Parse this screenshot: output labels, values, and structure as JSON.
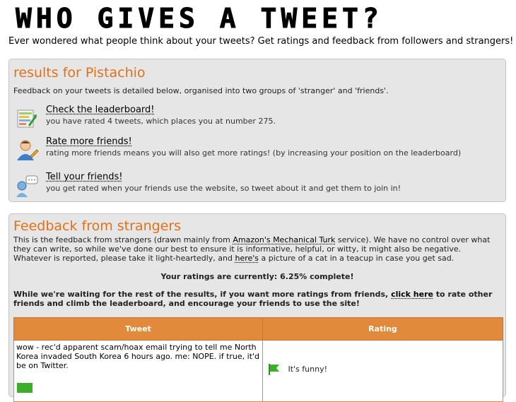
{
  "site": {
    "title": "WHO GIVES A TWEET?",
    "tagline": "Ever wondered what people think about your tweets? Get ratings and feedback from followers and strangers!"
  },
  "results": {
    "heading": "results for Pistachio",
    "intro": "Feedback on your tweets is detailed below, organised into two groups of 'stranger' and 'friends'.",
    "items": [
      {
        "icon": "leaderboard-icon",
        "title": "Check the leaderboard!",
        "desc": "you have rated 4 tweets, which places you at number 275."
      },
      {
        "icon": "rate-friends-icon",
        "title": "Rate more friends!",
        "desc": "rating more friends means you will also get more ratings! (by increasing your position on the leaderboard)"
      },
      {
        "icon": "tell-friends-icon",
        "title": "Tell your friends!",
        "desc": "you get rated when your friends use the website, so tweet about it and get them to join in!"
      }
    ]
  },
  "feedback": {
    "heading": "Feedback from strangers",
    "p1_a": "This is the feedback from strangers (drawn mainly from ",
    "p1_link": "Amazon's Mechanical Turk",
    "p1_b": " service). We have no control over what they can write, so while we've done our best to ensure it is informative, helpful, or witty, it might also be negative. Whatever is reported, please take it light-heartedly, and ",
    "p1_link2": "here's",
    "p1_c": " a picture of a cat in a teacup in case you get sad.",
    "progress": "Your ratings are currently: 6.25% complete!",
    "p3_a": "While we're waiting for the rest of the results, if you want more ratings from friends, ",
    "p3_link": "click here",
    "p3_b": " to rate other friends and climb the leaderboard, and encourage your friends to use the site!",
    "table": {
      "headers": [
        "Tweet",
        "Rating"
      ],
      "rows": [
        {
          "tweet": "wow - rec'd apparent scam/hoax email trying to tell me North Korea invaded South Korea 6 hours ago. me: NOPE. if true, it'd be on Twitter.",
          "rating": "It's funny!"
        }
      ]
    }
  }
}
